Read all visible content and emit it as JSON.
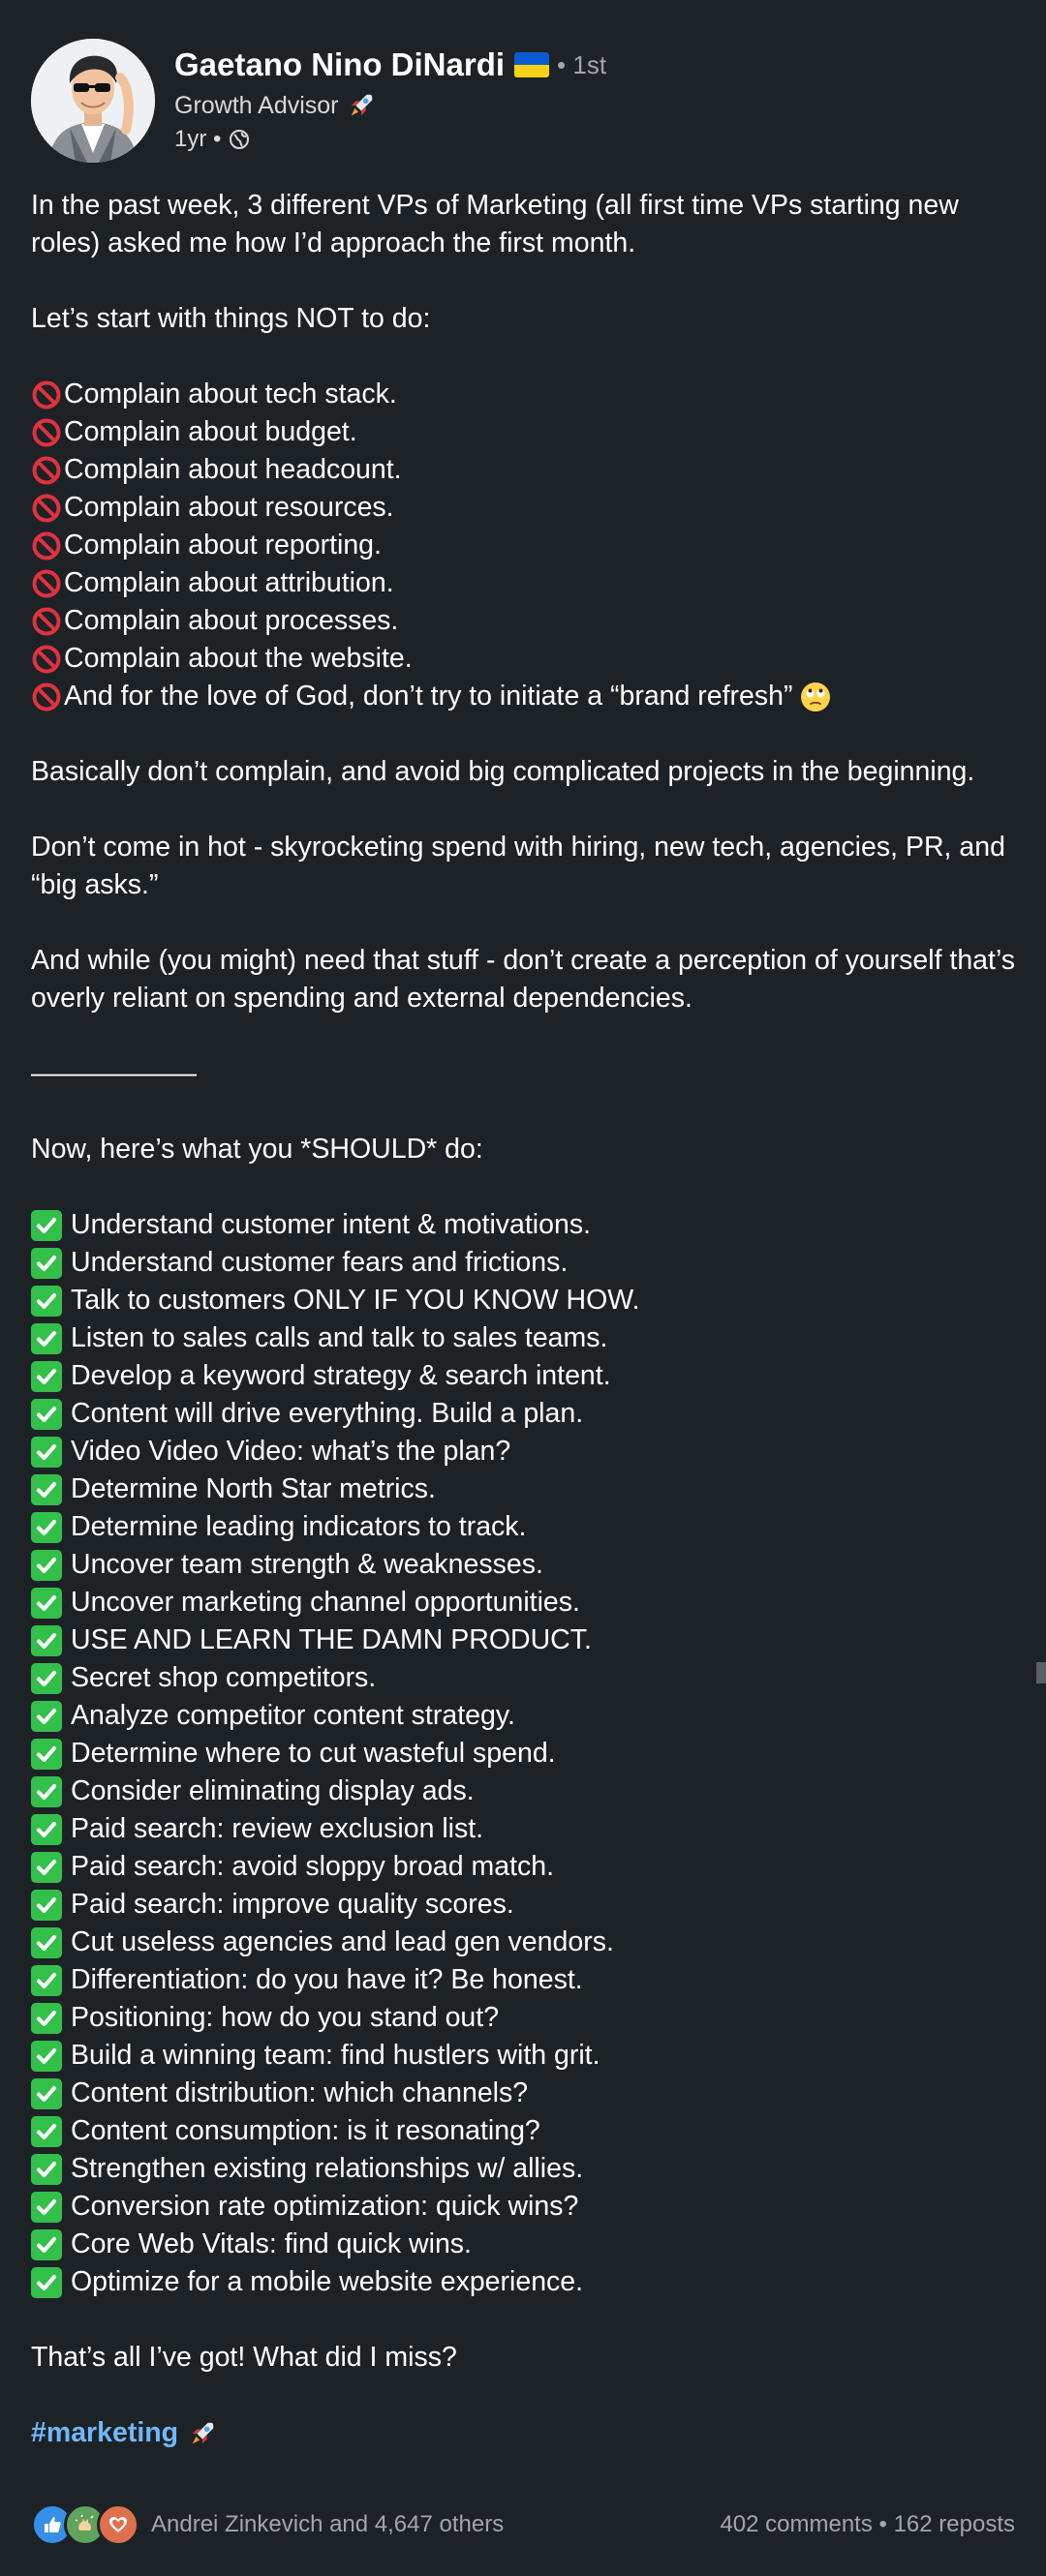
{
  "author": {
    "name": "Gaetano Nino DiNardi",
    "degree": "• 1st",
    "headline": "Growth Advisor",
    "time": "1yr •"
  },
  "post": {
    "intro": "In the past week, 3 different VPs of Marketing (all first time VPs starting new roles) asked me how I’d approach the first month.",
    "not_heading": "Let’s start with things NOT to do:",
    "dont_items": [
      "Complain about tech stack.",
      "Complain about budget.",
      "Complain about headcount.",
      "Complain about resources.",
      "Complain about reporting.",
      "Complain about attribution.",
      "Complain about processes.",
      "Complain about the website.",
      "And for the love of God, don’t try to initiate a “brand refresh”"
    ],
    "basically": "Basically don’t complain, and avoid big complicated projects in the beginning.",
    "hot": "Don’t come in hot - skyrocketing spend with hiring, new tech, agencies, PR, and “big asks.”",
    "while": "And while (you might) need that stuff - don’t create a perception of yourself that’s overly reliant on spending and external dependencies.",
    "divider": "——————",
    "should_heading": "Now, here’s what you *SHOULD* do:",
    "do_items": [
      "Understand customer intent & motivations.",
      "Understand customer fears and frictions.",
      "Talk to customers ONLY IF YOU KNOW HOW.",
      "Listen to sales calls and talk to sales teams.",
      "Develop a keyword strategy & search intent.",
      "Content will drive everything. Build a plan.",
      "Video Video Video: what’s the plan?",
      "Determine North Star metrics.",
      "Determine leading indicators to track.",
      "Uncover team strength & weaknesses.",
      "Uncover marketing channel opportunities.",
      "USE AND LEARN THE DAMN PRODUCT.",
      "Secret shop competitors.",
      "Analyze competitor content strategy.",
      "Determine where to cut wasteful spend.",
      "Consider eliminating display ads.",
      "Paid search: review exclusion list.",
      "Paid search: avoid sloppy broad match.",
      "Paid search: improve quality scores.",
      "Cut useless agencies and lead gen vendors.",
      "Differentiation: do you have it? Be honest.",
      "Positioning: how do you stand out?",
      "Build a winning team: find hustlers with grit.",
      "Content distribution: which channels?",
      "Content consumption: is it resonating?",
      "Strengthen existing relationships w/ allies.",
      "Conversion rate optimization: quick wins?",
      "Core Web Vitals: find quick wins.",
      "Optimize for a mobile website experience."
    ],
    "closing": "That’s all I’ve got! What did I miss?",
    "hashtag": "#marketing"
  },
  "social": {
    "reactions_text": "Andrei Zinkevich and 4,647 others",
    "counts_text": "402 comments • 162 reposts"
  },
  "icons": {
    "dont": "prohibited-icon",
    "do": "check-mark-icon",
    "eyes": "face-with-rolling-eyes-icon",
    "rocket": "rocket-icon",
    "visibility": "globe-icon"
  },
  "colors": {
    "background": "#1d2226",
    "hashtag": "#71b7fb",
    "check": "#33c04a",
    "prohibited": "#e0323f"
  }
}
